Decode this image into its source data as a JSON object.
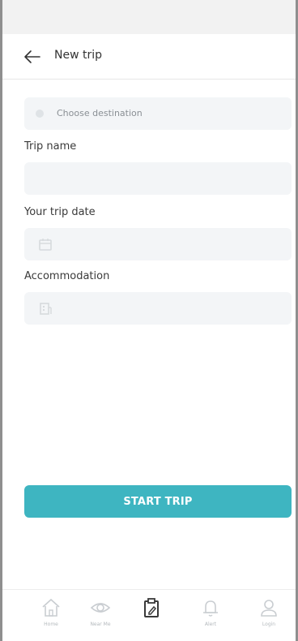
{
  "header": {
    "title": "New trip"
  },
  "form": {
    "destination_placeholder": "Choose destination",
    "trip_name_label": "Trip name",
    "trip_date_label": "Your trip date",
    "accommodation_label": "Accommodation"
  },
  "actions": {
    "start_label": "START TRIP"
  },
  "icons": {
    "back": "arrow-left-icon",
    "calendar": "calendar-icon",
    "building": "building-icon",
    "home": "home-icon",
    "explore": "eye-icon",
    "trip": "clipboard-edit-icon",
    "notifications": "bell-icon",
    "profile": "user-icon"
  },
  "nav": {
    "items": [
      {
        "label": "Home"
      },
      {
        "label": "Near Me"
      },
      {
        "label": ""
      },
      {
        "label": "Alert"
      },
      {
        "label": "Login"
      }
    ]
  },
  "colors": {
    "accent": "#3eb5c1",
    "field_bg": "#f3f5f7",
    "nav_icon": "#c9cdd1"
  }
}
